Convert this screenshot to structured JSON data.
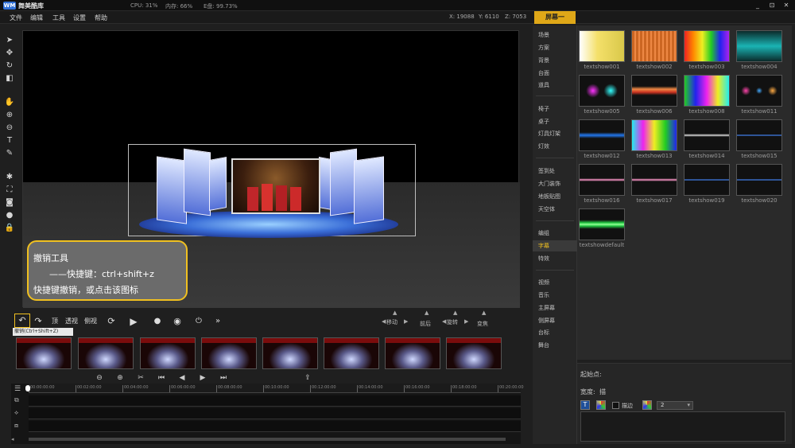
{
  "app": {
    "name": "舞美酷库",
    "logo_mark": "WM"
  },
  "status": {
    "cpu": "CPU: 31%",
    "mem": "内存: 66%",
    "disk": "E盘: 99.73%"
  },
  "window_buttons": [
    "_",
    "⊡",
    "✕"
  ],
  "menu": [
    "文件",
    "编辑",
    "工具",
    "设置",
    "帮助"
  ],
  "coords": {
    "x": "X: 19088",
    "y": "Y: 6110",
    "z": "Z: 7053"
  },
  "screen_tab": "屏幕一",
  "tooltip": {
    "line1": "撤销工具",
    "line2": "——快捷键：ctrl+shift+z",
    "line3": "快捷键撤销，或点击该图标"
  },
  "playbar": {
    "undo_tip": "撤销(Ctrl+Shift+Z)",
    "top_label": "顶",
    "persp_label": "透视",
    "side_label": "侧视",
    "dpads": [
      "移动",
      "前后",
      "旋转",
      "变焦"
    ]
  },
  "timeline_ticks": [
    "00:00:00:00",
    "00:02:00:00",
    "00:04:00:00",
    "00:06:00:00",
    "00:08:00:00",
    "00:10:00:00",
    "00:12:00:00",
    "00:14:00:00",
    "00:16:00:00",
    "00:18:00:00",
    "00:20:00:00"
  ],
  "categories": [
    {
      "label": "场景"
    },
    {
      "label": "方案"
    },
    {
      "label": "背景"
    },
    {
      "label": "台面"
    },
    {
      "label": "道具"
    },
    {
      "label": "椅子"
    },
    {
      "label": "桌子"
    },
    {
      "label": "灯具灯架"
    },
    {
      "label": "灯效"
    },
    {
      "label": "签到处"
    },
    {
      "label": "大门装饰"
    },
    {
      "label": "地板贴图"
    },
    {
      "label": "天空体"
    },
    {
      "label": "编组"
    },
    {
      "label": "字幕",
      "selected": true
    },
    {
      "label": "特效"
    },
    {
      "label": "视频"
    },
    {
      "label": "音乐"
    },
    {
      "label": "主屏幕"
    },
    {
      "label": "侧屏幕"
    },
    {
      "label": "台标"
    },
    {
      "label": "舞台"
    }
  ],
  "gallery": [
    {
      "caption": "textshow001",
      "style": "yellow"
    },
    {
      "caption": "textshow002",
      "style": "redgrid"
    },
    {
      "caption": "textshow003",
      "style": "rainbow"
    },
    {
      "caption": "textshow004",
      "style": "teal"
    },
    {
      "caption": "textshow005",
      "style": "sparkle"
    },
    {
      "caption": "textshow006",
      "style": "orange"
    },
    {
      "caption": "textshow008",
      "style": "colorful"
    },
    {
      "caption": "textshow011",
      "style": "dots"
    },
    {
      "caption": "textshow012",
      "style": "blueline"
    },
    {
      "caption": "textshow013",
      "style": "multi"
    },
    {
      "caption": "textshow014",
      "style": "whiteline"
    },
    {
      "caption": "textshow015",
      "style": "thinblue"
    },
    {
      "caption": "textshow016",
      "style": "pinkline"
    },
    {
      "caption": "textshow017",
      "style": "pinkline"
    },
    {
      "caption": "textshow019",
      "style": "thinblue"
    },
    {
      "caption": "textshow020",
      "style": "thinblue"
    },
    {
      "caption": "textshowdefault",
      "style": "green"
    }
  ],
  "props": {
    "start_label": "起始点:",
    "width_label": "宽度:",
    "width_value": "描",
    "stroke_label": "描边",
    "size_value": "2"
  }
}
